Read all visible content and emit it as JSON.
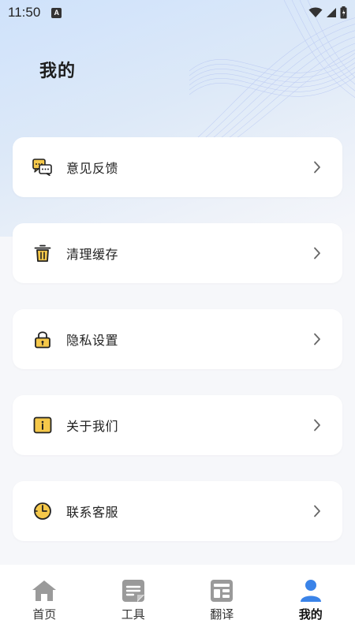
{
  "status": {
    "time": "11:50",
    "badge": "A"
  },
  "page": {
    "title": "我的"
  },
  "menu": [
    {
      "label": "意见反馈",
      "icon": "feedback-chat-icon"
    },
    {
      "label": "清理缓存",
      "icon": "trash-icon"
    },
    {
      "label": "隐私设置",
      "icon": "lock-icon"
    },
    {
      "label": "关于我们",
      "icon": "info-icon"
    },
    {
      "label": "联系客服",
      "icon": "clock-icon"
    }
  ],
  "tabs": [
    {
      "label": "首页",
      "icon": "home-icon",
      "active": false
    },
    {
      "label": "工具",
      "icon": "tools-icon",
      "active": false
    },
    {
      "label": "翻译",
      "icon": "translate-icon",
      "active": false
    },
    {
      "label": "我的",
      "icon": "person-icon",
      "active": true
    }
  ],
  "colors": {
    "accent": "#3a83e8",
    "icon_yellow": "#f5c84a",
    "inactive_tab": "#9a9a9a"
  }
}
